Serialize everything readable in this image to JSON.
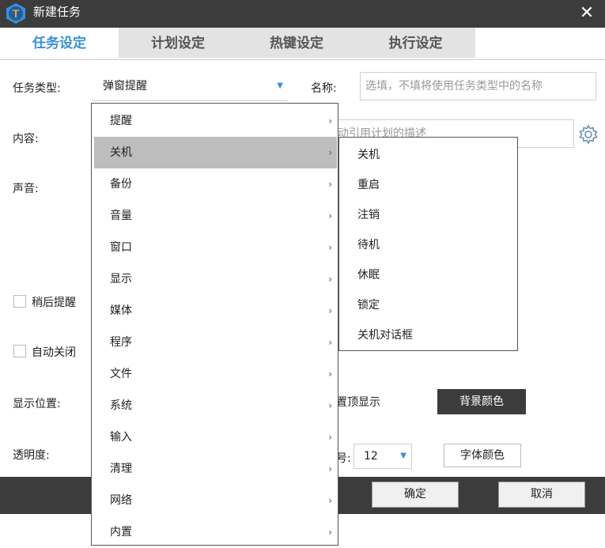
{
  "window": {
    "title": "新建任务",
    "close": "✕"
  },
  "tabs": [
    "任务设定",
    "计划设定",
    "热键设定",
    "执行设定"
  ],
  "form": {
    "task_type_label": "任务类型:",
    "task_type_value": "弹窗提醒",
    "name_label": "名称:",
    "name_placeholder": "选填，不填将使用任务类型中的名称",
    "content_label": "内容:",
    "content_partial": "动引用计划的描述",
    "sound_label": "声音:",
    "remind_later_label": "稍后提醒",
    "auto_close_label": "自动关闭",
    "position_label": "显示位置:",
    "topmost_partial": "置顶显示",
    "bg_color_button": "背景颜色",
    "opacity_label": "透明度:",
    "font_size_partial": "号:",
    "font_size_value": "12",
    "font_color_button": "字体颜色"
  },
  "footer": {
    "ok": "确定",
    "cancel": "取消"
  },
  "menu": {
    "items": [
      "提醒",
      "关机",
      "备份",
      "音量",
      "窗口",
      "显示",
      "媒体",
      "程序",
      "文件",
      "系统",
      "输入",
      "清理",
      "网络",
      "内置"
    ],
    "highlighted": "关机",
    "chevron": "›"
  },
  "submenu": {
    "items": [
      "关机",
      "重启",
      "注销",
      "待机",
      "休眠",
      "锁定",
      "关机对话框"
    ]
  },
  "colors": {
    "accent": "#3b8fd9",
    "dark_bar": "#3c3c3c",
    "highlight": "#bdbdbd"
  }
}
